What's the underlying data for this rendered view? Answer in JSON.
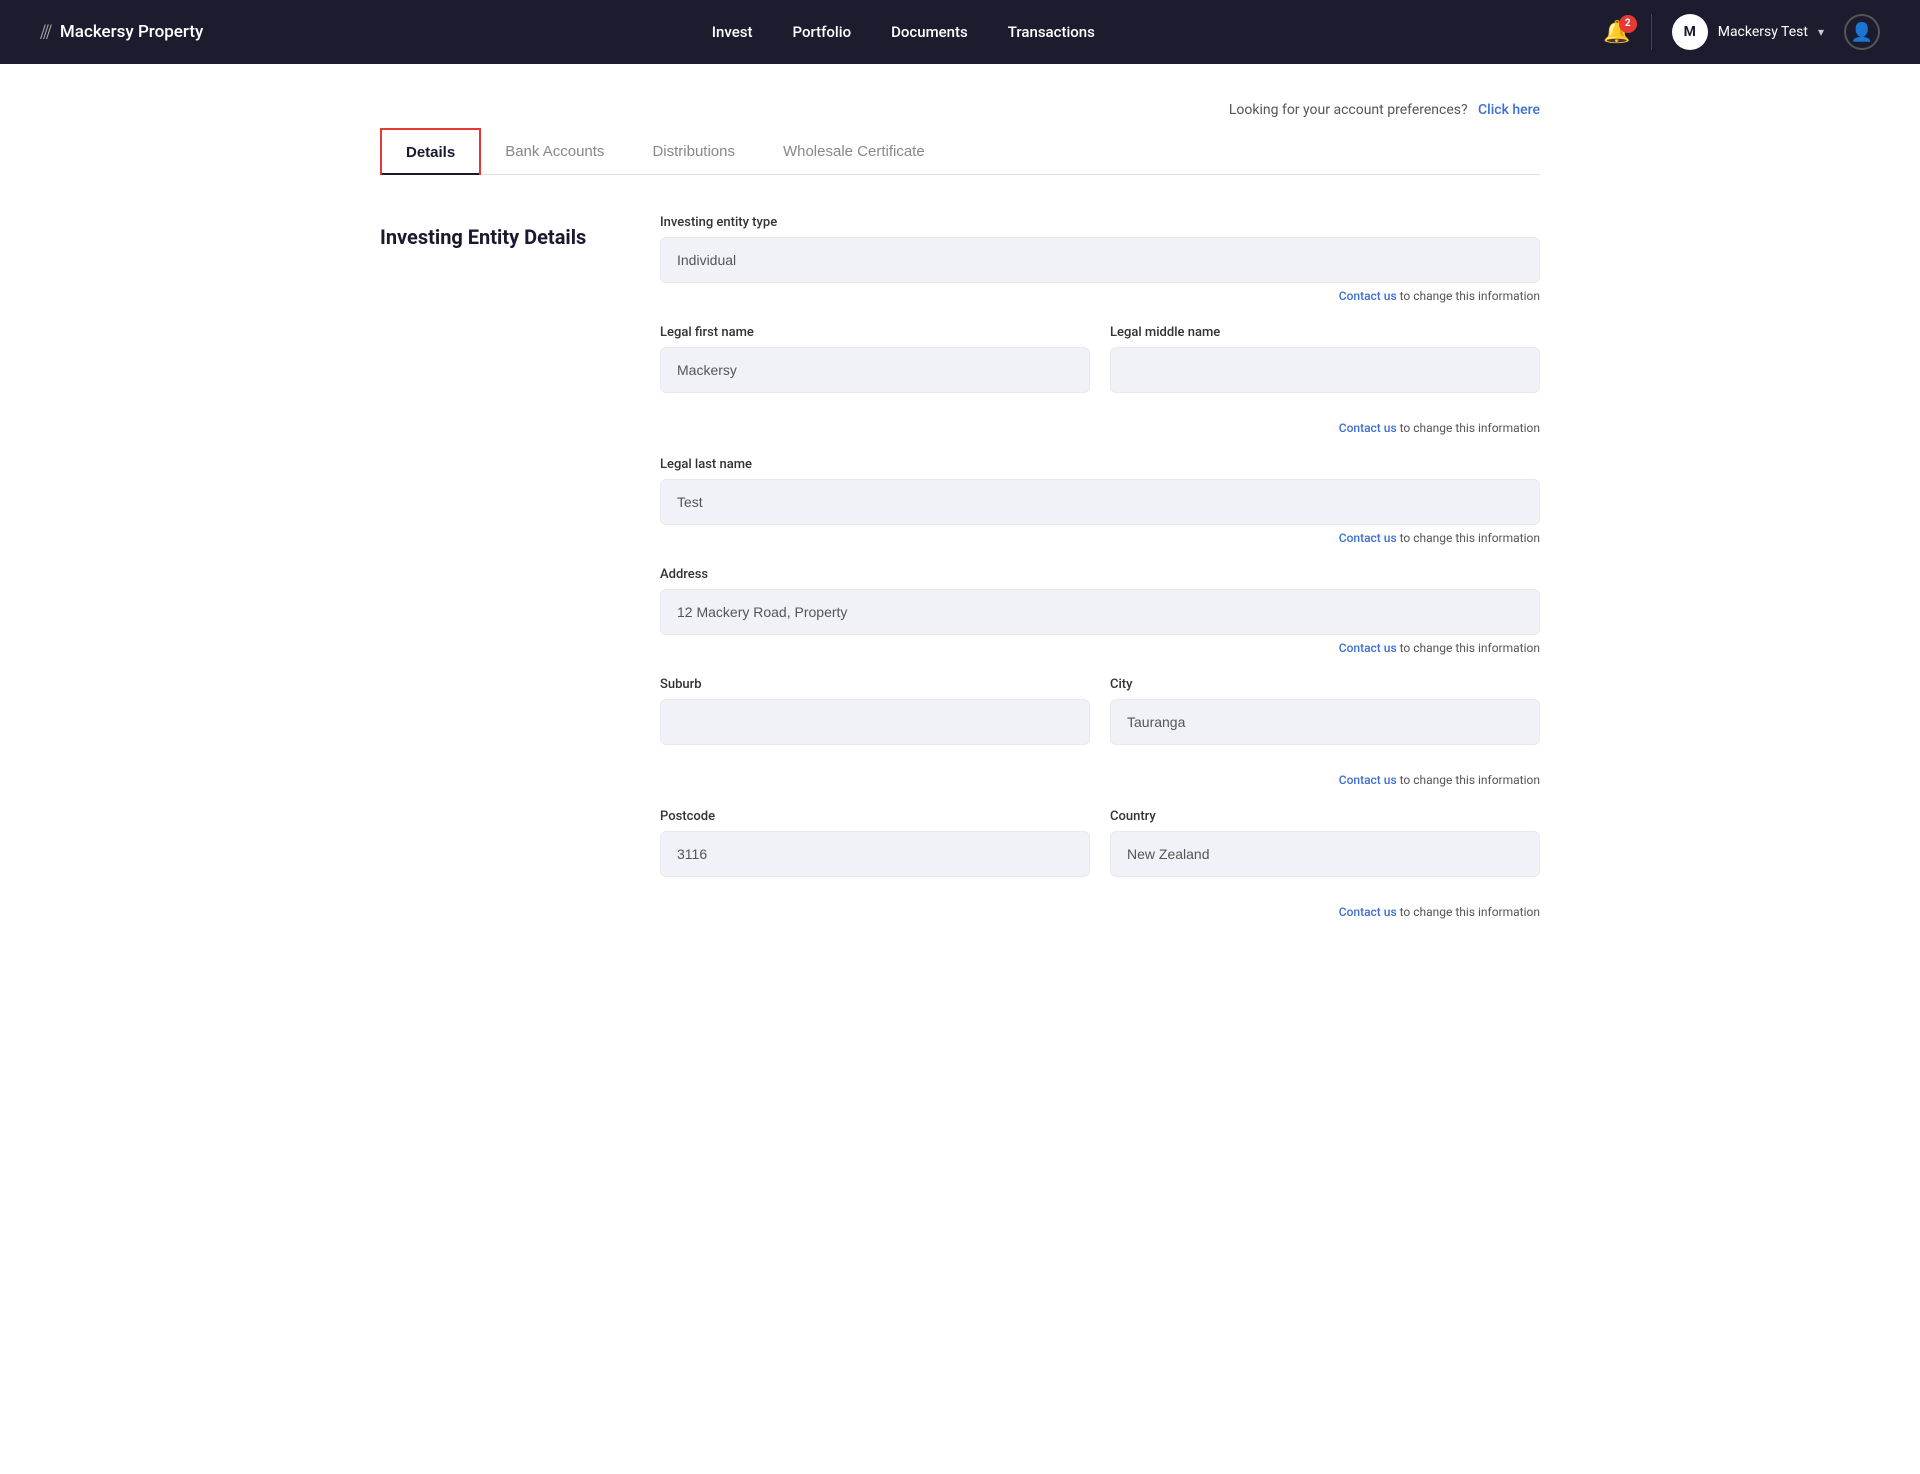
{
  "brand": {
    "logo_icon": "///",
    "name": "Mackersy Property"
  },
  "navbar": {
    "links": [
      {
        "label": "Invest",
        "href": "#"
      },
      {
        "label": "Portfolio",
        "href": "#"
      },
      {
        "label": "Documents",
        "href": "#"
      },
      {
        "label": "Transactions",
        "href": "#"
      }
    ],
    "notification_count": "2",
    "user_initial": "M",
    "user_name": "Mackersy Test"
  },
  "account_pref": {
    "text": "Looking for your account preferences?",
    "link_label": "Click here"
  },
  "tabs": [
    {
      "label": "Details",
      "active": true
    },
    {
      "label": "Bank Accounts",
      "active": false
    },
    {
      "label": "Distributions",
      "active": false
    },
    {
      "label": "Wholesale Certificate",
      "active": false
    }
  ],
  "form": {
    "section_title": "Investing Entity Details",
    "fields": {
      "entity_type_label": "Investing entity type",
      "entity_type_value": "Individual",
      "first_name_label": "Legal first name",
      "first_name_value": "Mackersy",
      "middle_name_label": "Legal middle name",
      "middle_name_value": "",
      "last_name_label": "Legal last name",
      "last_name_value": "Test",
      "address_label": "Address",
      "address_value": "12 Mackery Road, Property",
      "suburb_label": "Suburb",
      "suburb_value": "",
      "city_label": "City",
      "city_value": "Tauranga",
      "postcode_label": "Postcode",
      "postcode_value": "3116",
      "country_label": "Country",
      "country_value": "New Zealand"
    },
    "contact_note_text": "to change this information",
    "contact_link_label": "Contact us"
  }
}
